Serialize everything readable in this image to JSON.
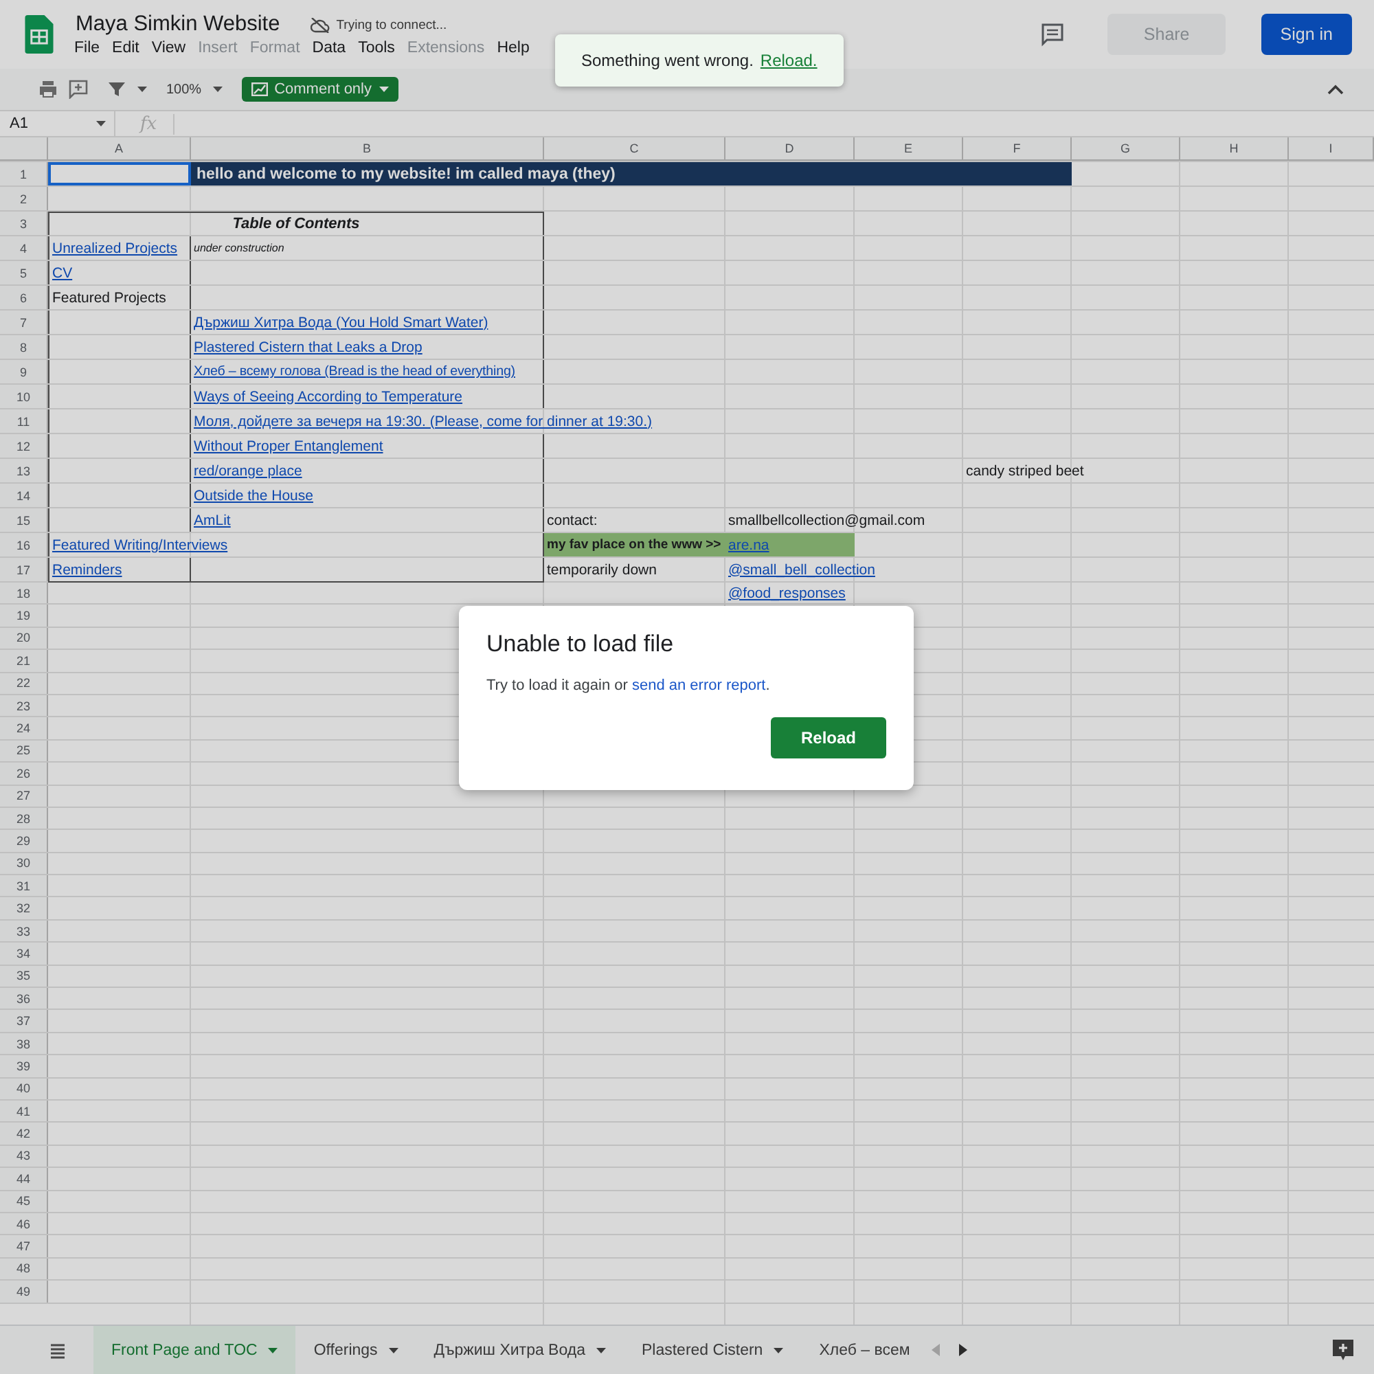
{
  "title_bar": {
    "title": "Maya Simkin Website",
    "status": "Trying to connect...",
    "share": "Share",
    "sign_in": "Sign in"
  },
  "menus": [
    {
      "label": "File",
      "disabled": false
    },
    {
      "label": "Edit",
      "disabled": false
    },
    {
      "label": "View",
      "disabled": false
    },
    {
      "label": "Insert",
      "disabled": true
    },
    {
      "label": "Format",
      "disabled": true
    },
    {
      "label": "Data",
      "disabled": false
    },
    {
      "label": "Tools",
      "disabled": false
    },
    {
      "label": "Extensions",
      "disabled": true
    },
    {
      "label": "Help",
      "disabled": false
    }
  ],
  "toolbar": {
    "zoom": "100%",
    "mode": "Comment only"
  },
  "formula_bar": {
    "name_box": "A1",
    "fx": "fx"
  },
  "columns": [
    "A",
    "B",
    "C",
    "D",
    "E",
    "F",
    "G",
    "H",
    "I"
  ],
  "rows": [
    {
      "number": "1",
      "cells": {
        "A": {
          "kind": "empty",
          "selected": true,
          "highlighted": false
        },
        "B": {
          "text": "hello and welcome to my website! im called maya (they)",
          "kind": "banner",
          "selected": false,
          "highlighted": false
        }
      }
    },
    {
      "number": "2"
    },
    {
      "number": "3",
      "cells": {
        "A": {
          "text": "Table of Contents",
          "kind": "heading",
          "selected": false,
          "highlighted": false
        }
      }
    },
    {
      "number": "4",
      "cells": {
        "A": {
          "text": "Unrealized Projects",
          "kind": "link",
          "selected": false,
          "highlighted": false
        },
        "B": {
          "text": "under construction",
          "kind": "note",
          "selected": false,
          "highlighted": false
        }
      }
    },
    {
      "number": "5",
      "cells": {
        "A": {
          "text": "CV",
          "kind": "link",
          "selected": false,
          "highlighted": false
        }
      }
    },
    {
      "number": "6",
      "cells": {
        "A": {
          "text": "Featured Projects",
          "kind": "text",
          "selected": false,
          "highlighted": false
        }
      }
    },
    {
      "number": "7",
      "cells": {
        "B": {
          "text": "Държиш Хитра Вода (You Hold Smart Water)",
          "kind": "link",
          "selected": false,
          "highlighted": false
        }
      }
    },
    {
      "number": "8",
      "cells": {
        "B": {
          "text": "Plastered Cistern that Leaks a Drop",
          "kind": "link",
          "selected": false,
          "highlighted": false
        }
      }
    },
    {
      "number": "9",
      "cells": {
        "B": {
          "text": "Хлеб – всему голова (Bread is the head of everything)",
          "kind": "link",
          "selected": false,
          "highlighted": false
        }
      }
    },
    {
      "number": "10",
      "cells": {
        "B": {
          "text": "Ways of Seeing According to Temperature",
          "kind": "link",
          "selected": false,
          "highlighted": false
        }
      }
    },
    {
      "number": "11",
      "cells": {
        "B": {
          "text": "Моля, дойдете за вечеря на 19:30. (Please, come for dinner at 19:30.)",
          "kind": "link",
          "selected": false,
          "highlighted": false
        }
      }
    },
    {
      "number": "12",
      "cells": {
        "B": {
          "text": "Without Proper Entanglement",
          "kind": "link",
          "selected": false,
          "highlighted": false
        }
      }
    },
    {
      "number": "13",
      "cells": {
        "B": {
          "text": "red/orange place",
          "kind": "link",
          "selected": false,
          "highlighted": false
        },
        "F": {
          "text": "candy striped beet",
          "kind": "text",
          "selected": false,
          "highlighted": false
        }
      }
    },
    {
      "number": "14",
      "cells": {
        "B": {
          "text": "Outside the House",
          "kind": "link",
          "selected": false,
          "highlighted": false
        }
      }
    },
    {
      "number": "15",
      "cells": {
        "B": {
          "text": "AmLit",
          "kind": "link",
          "selected": false,
          "highlighted": false
        },
        "C": {
          "text": "contact:",
          "kind": "text",
          "selected": false,
          "highlighted": false
        },
        "D": {
          "text": "smallbellcollection@gmail.com",
          "kind": "text",
          "selected": false,
          "highlighted": false
        }
      }
    },
    {
      "number": "16",
      "cells": {
        "A": {
          "text": "Featured Writing/Interviews",
          "kind": "link",
          "selected": false,
          "highlighted": false
        },
        "C": {
          "text": "my fav place on the www >>",
          "kind": "label",
          "selected": false,
          "highlighted": true
        },
        "D": {
          "text": "are.na",
          "kind": "link",
          "selected": false,
          "highlighted": true
        }
      }
    },
    {
      "number": "17",
      "cells": {
        "A": {
          "text": "Reminders",
          "kind": "link",
          "selected": false,
          "highlighted": false
        },
        "C": {
          "text": "temporarily down",
          "kind": "text",
          "selected": false,
          "highlighted": false
        },
        "D": {
          "text": "@small_bell_collection",
          "kind": "link",
          "selected": false,
          "highlighted": false
        }
      }
    },
    {
      "number": "18",
      "cells": {
        "D": {
          "text": "@food_responses",
          "kind": "link",
          "selected": false,
          "highlighted": false
        }
      }
    },
    {
      "number": "19"
    },
    {
      "number": "20"
    },
    {
      "number": "21"
    },
    {
      "number": "22"
    },
    {
      "number": "23"
    },
    {
      "number": "24"
    },
    {
      "number": "25"
    },
    {
      "number": "26"
    },
    {
      "number": "27"
    },
    {
      "number": "28"
    },
    {
      "number": "29"
    },
    {
      "number": "30"
    },
    {
      "number": "31"
    },
    {
      "number": "32"
    },
    {
      "number": "33"
    },
    {
      "number": "34"
    },
    {
      "number": "35"
    },
    {
      "number": "36"
    },
    {
      "number": "37"
    },
    {
      "number": "38"
    },
    {
      "number": "39"
    },
    {
      "number": "40"
    },
    {
      "number": "41"
    },
    {
      "number": "42"
    },
    {
      "number": "43"
    },
    {
      "number": "44"
    },
    {
      "number": "45"
    },
    {
      "number": "46"
    },
    {
      "number": "47"
    },
    {
      "number": "48"
    },
    {
      "number": "49"
    }
  ],
  "sheet_tabs": [
    {
      "label": "Front Page and TOC",
      "selected": true
    },
    {
      "label": "Offerings",
      "selected": false
    },
    {
      "label": "Държиш Хитра Вода",
      "selected": false
    },
    {
      "label": "Plastered Cistern",
      "selected": false
    },
    {
      "label": "Хлеб – всем",
      "selected": false
    }
  ],
  "toast": {
    "message": "Something went wrong.",
    "link": "Reload."
  },
  "dialog": {
    "title": "Unable to load file",
    "text": "Try to load it again or",
    "link": "send an error report",
    "after_link": ".",
    "button": "Reload"
  }
}
